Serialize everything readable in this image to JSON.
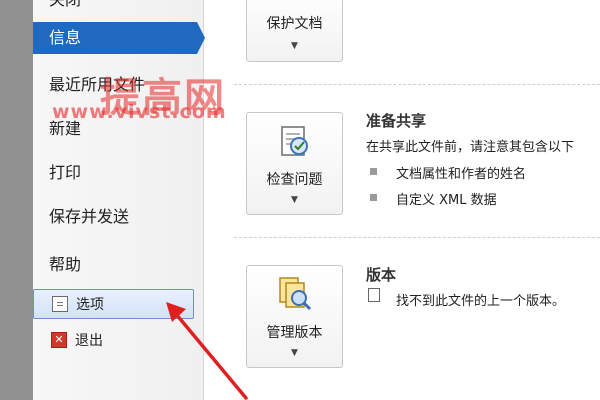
{
  "sidebar": {
    "top_partial_label": "关闭",
    "active_label": "信息",
    "items": [
      {
        "label": "最近所用文件"
      },
      {
        "label": "新建"
      },
      {
        "label": "打印"
      },
      {
        "label": "保存并发送"
      },
      {
        "label": "帮助"
      }
    ],
    "options_label": "选项",
    "exit_label": "退出"
  },
  "watermark": {
    "brand": "提高网",
    "url": "www.vivst.com"
  },
  "main": {
    "protect": {
      "button_label": "保护文档",
      "caret": "▼"
    },
    "inspect": {
      "button_label": "检查问题",
      "caret": "▼",
      "title": "准备共享",
      "desc": "在共享此文件前，请注意其包含以下",
      "bullets": [
        "文档属性和作者的姓名",
        "自定义 XML 数据"
      ]
    },
    "versions": {
      "button_label": "管理版本",
      "caret": "▼",
      "title": "版本",
      "desc": "找不到此文件的上一个版本。"
    }
  },
  "colors": {
    "active": "#1f69c0",
    "annotation_arrow": "#e02020"
  }
}
